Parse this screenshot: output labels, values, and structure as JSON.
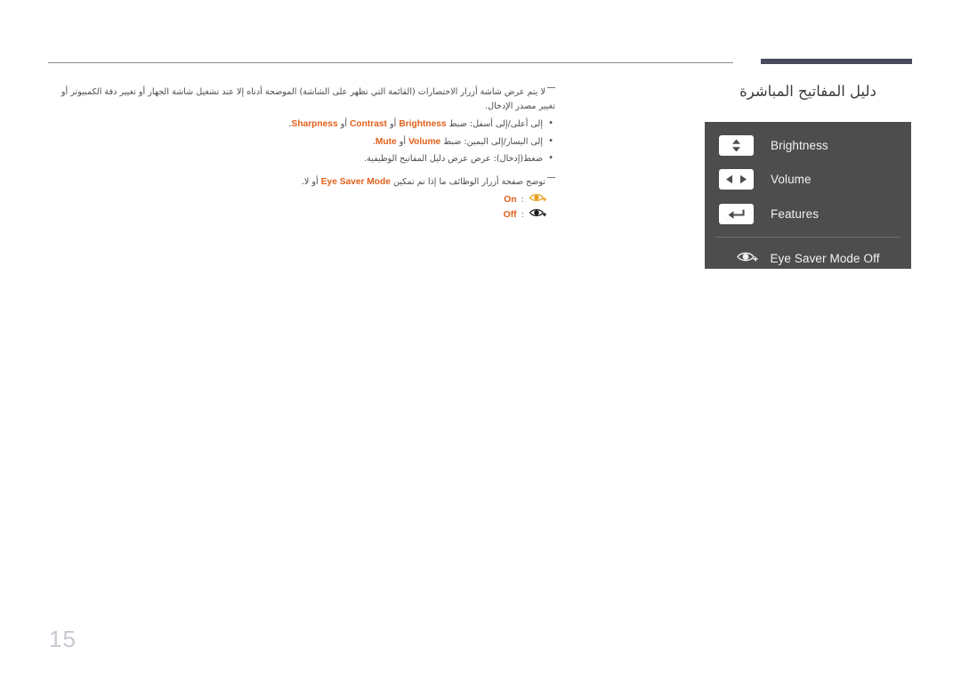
{
  "page": {
    "number": "15",
    "language": "ar"
  },
  "header": {
    "rule_color": "#8c8c96",
    "accent_bar_color": "#4a4a5e"
  },
  "guide": {
    "title": "دليل المفاتيح المباشرة",
    "panel_bg": "#4d4d4d",
    "rows": [
      {
        "icon": "up-down-arrow-icon",
        "label": "Brightness"
      },
      {
        "icon": "left-right-arrow-icon",
        "label": "Volume"
      },
      {
        "icon": "enter-return-arrow-icon",
        "label": "Features"
      }
    ],
    "eye_row": {
      "icon": "eye-saver-off-icon",
      "label": "Eye Saver Mode Off"
    }
  },
  "notes": {
    "note1": "لا يتم عرض شاشة أزرار الاختصارات (القائمة التي تظهر على الشاشة) الموضحة أدناه إلا عند تشغيل شاشة الجهاز أو تغيير دقة الكمبيوتر أو تغيير مصدر الإدخال.",
    "note2_before": "توضح صفحة أزرار الوظائف ما إذا تم تمكين",
    "note2_keyword": "Eye Saver Mode",
    "note2_after": "أو لا."
  },
  "bullets": [
    {
      "pre": "إلى أعلى/إلى أسفل: ضبط",
      "kw1": "Brightness",
      "mid1": "أو",
      "kw2": "Contrast",
      "mid2": "أو",
      "kw3": "Sharpness",
      "post": "."
    },
    {
      "pre": "إلى اليسار/إلى اليمين: ضبط",
      "kw1": "Volume",
      "mid1": "أو",
      "kw2": "Mute",
      "mid2": "",
      "kw3": "",
      "post": "."
    },
    {
      "pre": "ضغط(إدخال): عرض عرض دليل المفاتيح الوظيفية.",
      "kw1": "",
      "mid1": "",
      "kw2": "",
      "mid2": "",
      "kw3": "",
      "post": ""
    }
  ],
  "eye_states": {
    "on_label": "On",
    "off_label": "Off",
    "separator": ":",
    "on_icon": "eye-saver-on-icon",
    "off_icon": "eye-saver-off-icon"
  },
  "colors": {
    "keyword_orange": "#e2601b",
    "panel_gray": "#4d4d4d",
    "page_number_gray": "#c9c9d2"
  }
}
